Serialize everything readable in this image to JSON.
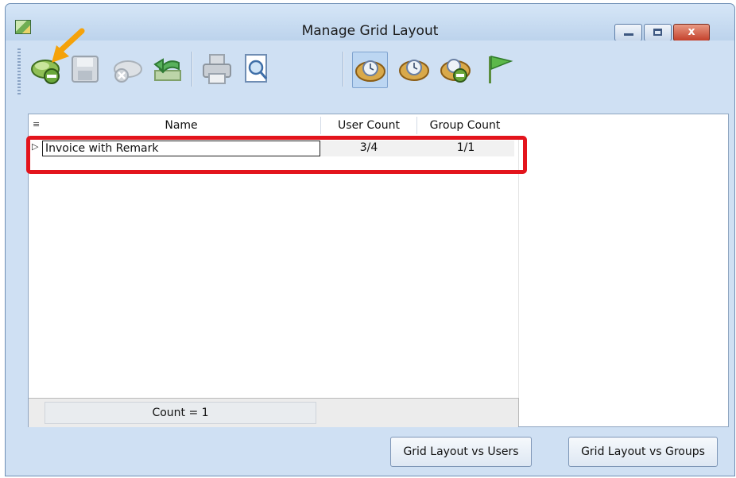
{
  "window": {
    "title": "Manage Grid Layout",
    "close_glyph": "x"
  },
  "toolbar": {
    "items": [
      {
        "name": "remove-layout-icon"
      },
      {
        "name": "save-icon"
      },
      {
        "name": "delete-icon"
      },
      {
        "name": "undo-icon"
      },
      {
        "name": "print-icon"
      },
      {
        "name": "print-preview-icon"
      },
      {
        "name": "layout-clock-icon"
      },
      {
        "name": "layout-clock-2-icon"
      },
      {
        "name": "layout-clock-remove-icon"
      },
      {
        "name": "flag-icon"
      }
    ]
  },
  "grid": {
    "columns": [
      "Name",
      "User Count",
      "Group Count"
    ],
    "rows": [
      {
        "name": "Invoice with Remark",
        "user_count": "3/4",
        "group_count": "1/1"
      }
    ],
    "footer": "Count = 1"
  },
  "buttons": {
    "layout_vs_users": "Grid Layout vs Users",
    "layout_vs_groups": "Grid Layout vs Groups"
  },
  "colors": {
    "highlight": "#e3141c",
    "arrow": "#f5a20a",
    "window_bg": "#cfe0f3"
  }
}
